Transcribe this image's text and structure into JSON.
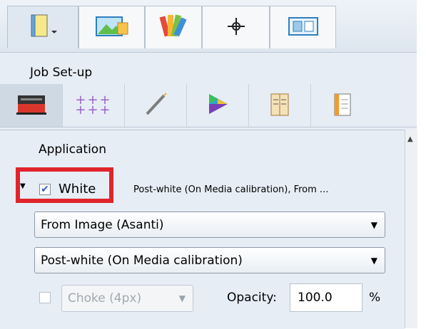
{
  "top_tabs": [
    {
      "icon": "book-icon",
      "active": true
    },
    {
      "icon": "image-icon"
    },
    {
      "icon": "color-swatches-icon"
    },
    {
      "icon": "crosshair-icon"
    },
    {
      "icon": "layout-icon"
    }
  ],
  "section_title": "Job Set-up",
  "sub_tabs": [
    {
      "icon": "printer-icon",
      "active": true
    },
    {
      "icon": "grid-dots-icon"
    },
    {
      "icon": "brush-icon"
    },
    {
      "icon": "color-triangle-icon"
    },
    {
      "icon": "notebook-icon"
    },
    {
      "icon": "document-icon"
    }
  ],
  "application": {
    "label": "Application",
    "white": {
      "checked": true,
      "label": "White",
      "summary": "Post-white (On Media calibration), From ..."
    },
    "source_select": "From Image (Asanti)",
    "mode_select": "Post-white (On Media calibration)",
    "choke": {
      "checked": false,
      "value": "Choke (4px)"
    },
    "opacity": {
      "label": "Opacity:",
      "value": "100.0",
      "unit": "%"
    }
  },
  "colors": {
    "highlight": "#e0242b",
    "check": "#2b5fb3"
  }
}
